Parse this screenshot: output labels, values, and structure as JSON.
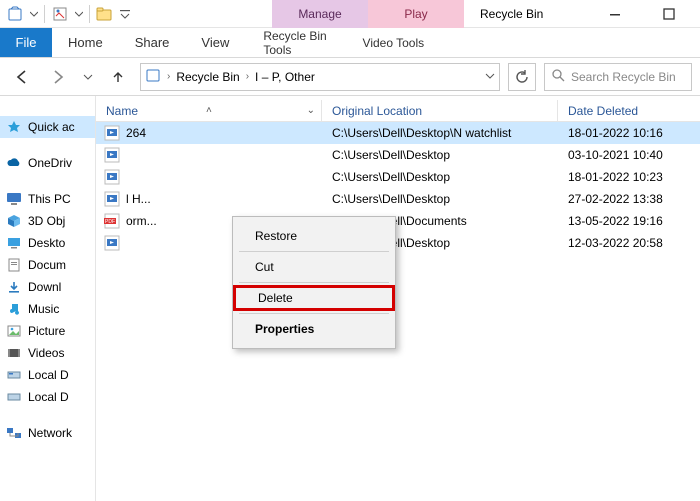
{
  "app_title": "Recycle Bin",
  "ribbon": {
    "file": "File",
    "tabs": [
      "Home",
      "Share",
      "View"
    ],
    "contextual": [
      {
        "head": "Manage",
        "sub": "Recycle Bin Tools"
      },
      {
        "head": "Play",
        "sub": "Video Tools"
      }
    ]
  },
  "breadcrumbs": [
    "Recycle Bin",
    "I – P, Other"
  ],
  "search_placeholder": "Search Recycle Bin",
  "columns": {
    "name": "Name",
    "orig": "Original Location",
    "date": "Date Deleted"
  },
  "nav": {
    "quick": "Quick ac",
    "onedrive": "OneDriv",
    "thispc": "This PC",
    "items": [
      "3D Obj",
      "Deskto",
      "Docum",
      "Downl",
      "Music",
      "Picture",
      "Videos",
      "Local D",
      "Local D"
    ],
    "network": "Network"
  },
  "rows": [
    {
      "name": "                                          264",
      "orig": "C:\\Users\\Dell\\Desktop\\N watchlist",
      "date": "18-01-2022 10:16",
      "type": "video",
      "selected": true
    },
    {
      "name": "",
      "orig": "C:\\Users\\Dell\\Desktop",
      "date": "03-10-2021 10:40",
      "type": "video"
    },
    {
      "name": "",
      "orig": "C:\\Users\\Dell\\Desktop",
      "date": "18-01-2022 10:23",
      "type": "video"
    },
    {
      "name": "                                        l H...",
      "orig": "C:\\Users\\Dell\\Desktop",
      "date": "27-02-2022 13:38",
      "type": "video"
    },
    {
      "name": "                                     orm...",
      "orig": "C:\\Users\\Dell\\Documents",
      "date": "13-05-2022 19:16",
      "type": "pdf"
    },
    {
      "name": "",
      "orig": "C:\\Users\\Dell\\Desktop",
      "date": "12-03-2022 20:58",
      "type": "video"
    }
  ],
  "context_menu": {
    "restore": "Restore",
    "cut": "Cut",
    "delete": "Delete",
    "properties": "Properties"
  }
}
